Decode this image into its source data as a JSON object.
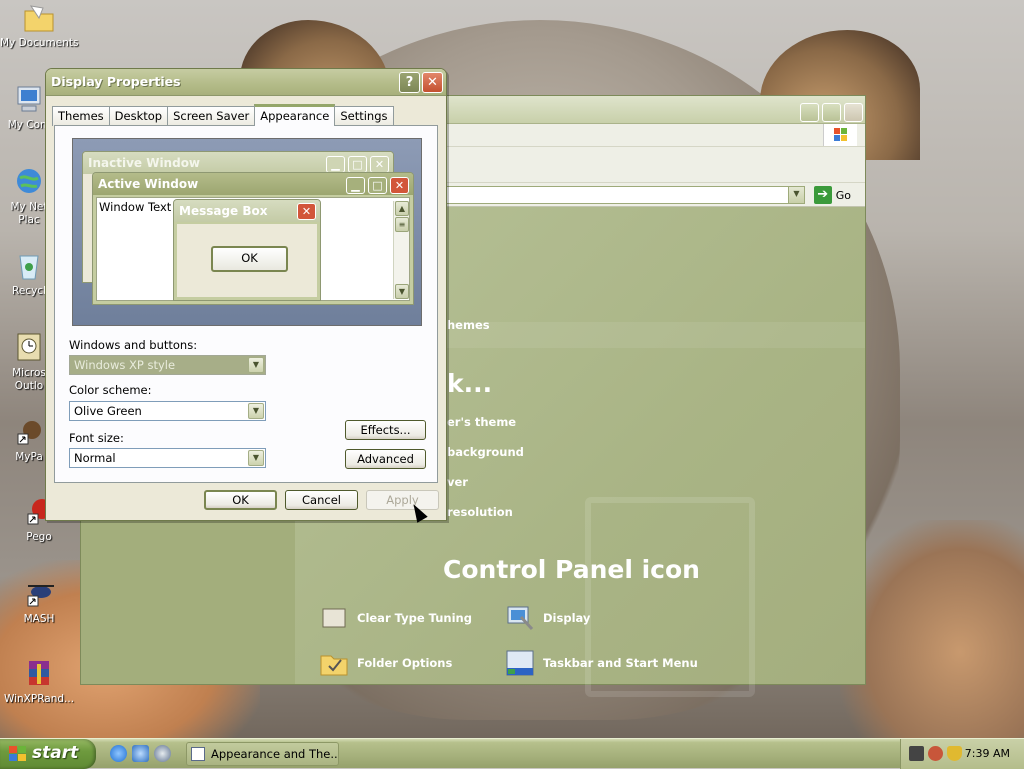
{
  "desktop": {
    "icons": [
      {
        "label": "My Documents"
      },
      {
        "label": "My Com"
      },
      {
        "label": "My Net\nPlac"
      },
      {
        "label": "Recycl"
      },
      {
        "label": "Micros\nOutlo"
      },
      {
        "label": "MyPa"
      },
      {
        "label": "Pego"
      },
      {
        "label": "MASH"
      },
      {
        "label": "WinXPRand..."
      }
    ]
  },
  "control_panel": {
    "address_go_label": "Go",
    "links": {
      "themes": "hemes",
      "pick_task": "k...",
      "change_theme": "er's theme",
      "change_background": "background",
      "screen_saver": "ver",
      "resolution": "resolution",
      "pick_icon": "Control Panel icon"
    },
    "items": {
      "fonts": "Clear Type Tuning",
      "display": "Display",
      "folder_options": "Folder Options",
      "taskbar": "Taskbar and Start Menu"
    }
  },
  "dialog": {
    "title": "Display Properties",
    "help_glyph": "?",
    "close_glyph": "✕",
    "tabs": [
      "Themes",
      "Desktop",
      "Screen Saver",
      "Appearance",
      "Settings"
    ],
    "active_tab": "Appearance",
    "preview": {
      "inactive_title": "Inactive Window",
      "active_title": "Active Window",
      "window_text": "Window Text",
      "message_title": "Message Box",
      "message_ok": "OK"
    },
    "windows_buttons_label": "Windows and buttons:",
    "windows_buttons_value": "Windows XP style",
    "color_scheme_label": "Color scheme:",
    "color_scheme_value": "Olive Green",
    "font_size_label": "Font size:",
    "font_size_value": "Normal",
    "effects_label": "Effects...",
    "advanced_label": "Advanced",
    "ok_label": "OK",
    "cancel_label": "Cancel",
    "apply_label": "Apply"
  },
  "taskbar": {
    "start_label": "start",
    "task_item": "Appearance and The...",
    "clock": "7:39 AM"
  },
  "colors": {
    "olive_title": "#b3bb88",
    "close_red": "#c4502f",
    "start_green": "#6e9a3e"
  }
}
